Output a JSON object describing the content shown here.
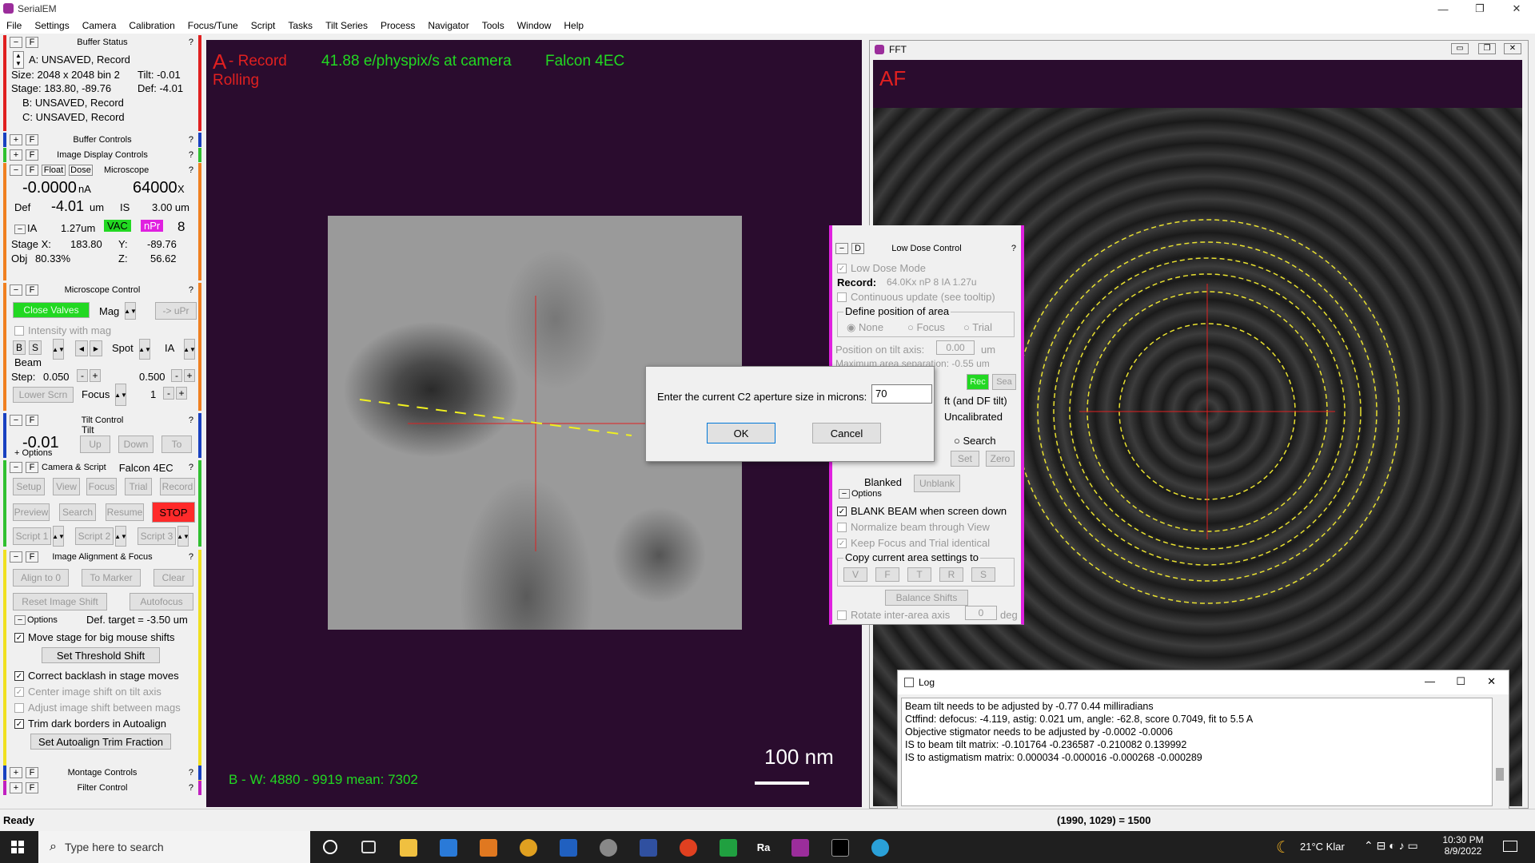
{
  "app": {
    "title": "SerialEM",
    "window_buttons": [
      "—",
      "❐",
      "✕"
    ]
  },
  "menu": [
    "File",
    "Settings",
    "Camera",
    "Calibration",
    "Focus/Tune",
    "Script",
    "Tasks",
    "Tilt Series",
    "Process",
    "Navigator",
    "Tools",
    "Window",
    "Help"
  ],
  "buffer_status": {
    "header": "Buffer Status",
    "a_line": "A: UNSAVED, Record",
    "size": "Size: 2048 x 2048  bin 2",
    "tilt": "Tilt: -0.01",
    "stage": "Stage: 183.80, -89.76",
    "def": "Def: -4.01",
    "b_line": "B: UNSAVED, Record",
    "c_line": "C: UNSAVED, Record"
  },
  "buffer_controls": "Buffer Controls",
  "image_display_controls": "Image Display Controls",
  "microscope": {
    "float_btn": "Float",
    "dose_btn": "Dose",
    "header": "Microscope",
    "current": "-0.0000",
    "current_unit": "nA",
    "mag": "64000",
    "mag_unit": "X",
    "def_label": "Def",
    "def_value": "-4.01",
    "def_unit": "um",
    "is_label": "IS",
    "is_value": "3.00 um",
    "ia_label": "IA",
    "ia_value": "1.27um",
    "vac": "VAC",
    "npr": "nPr",
    "spot": "8",
    "stage_x_label": "Stage X:",
    "stage_x": "183.80",
    "y_label": "Y:",
    "y": "-89.76",
    "obj_label": "Obj",
    "obj": "80.33%",
    "z_label": "Z:",
    "z": "56.62"
  },
  "microscope_control": {
    "header": "Microscope Control",
    "close_valves": "Close Valves",
    "mag": "Mag",
    "upr": "-> uPr",
    "intensity_with_mag": "Intensity with mag",
    "b": "B",
    "s": "S",
    "beam": "Beam",
    "spot": "Spot",
    "ia": "IA",
    "step_label": "Step:",
    "step1": "0.050",
    "step2": "0.500",
    "lower_scrn": "Lower Scrn",
    "focus": "Focus",
    "focus_step": "1"
  },
  "tilt_control": {
    "header": "Tilt Control",
    "tilt_label": "Tilt",
    "value": "-0.01",
    "up": "Up",
    "down": "Down",
    "to": "To",
    "options": "Options"
  },
  "camera_script": {
    "header": "Camera & Script",
    "camera": "Falcon 4EC",
    "setup": "Setup",
    "view": "View",
    "focus": "Focus",
    "trial": "Trial",
    "record": "Record",
    "preview": "Preview",
    "search": "Search",
    "resume": "Resume",
    "stop": "STOP",
    "script1": "Script 1",
    "script2": "Script 2",
    "script3": "Script 3"
  },
  "image_alignment": {
    "header": "Image Alignment & Focus",
    "align_to_0": "Align to 0",
    "to_marker": "To Marker",
    "clear": "Clear",
    "reset_is": "Reset Image Shift",
    "autofocus": "Autofocus",
    "options": "Options",
    "def_target": "Def. target = -3.50 um",
    "move_stage": "Move stage for big mouse shifts",
    "set_threshold": "Set Threshold Shift",
    "correct_backlash": "Correct backlash in stage moves",
    "center_is": "Center image shift on tilt axis",
    "adjust_is": "Adjust image shift between mags",
    "trim_dark": "Trim dark borders in Autoalign",
    "set_trim": "Set Autoalign Trim Fraction"
  },
  "montage_controls": "Montage Controls",
  "filter_control": "Filter Control",
  "image_window": {
    "a_label": "A",
    "record": " - Record",
    "rolling": "Rolling",
    "dose_rate": "41.88 e/physpix/s at camera",
    "camera": "Falcon 4EC",
    "bw": "B - W: 4880 - 9919  mean: 7302",
    "scale": "100 nm"
  },
  "fft_window": {
    "title": "FFT",
    "label": "AF"
  },
  "low_dose": {
    "d": "D",
    "header": "Low Dose Control",
    "mode": "Low Dose Mode",
    "record_label": "Record:",
    "record_info": "64.0Kx  nP 8  IA 1.27u",
    "continuous": "Continuous update (see tooltip)",
    "define": "Define position of area",
    "none": "None",
    "focus": "Focus",
    "trial": "Trial",
    "pos_label": "Position on tilt axis:",
    "pos_value": "0.00",
    "pos_unit": "um",
    "max_sep": "Maximum area separation: -0.55 um",
    "rec": "Rec",
    "sea": "Sea",
    "df_tilt": "ft (and DF tilt)",
    "uncal": "Uncalibrated",
    "search": "Search",
    "set": "Set",
    "zero": "Zero",
    "blanked": "Blanked",
    "unblank": "Unblank",
    "options": "Options",
    "blank_beam": "BLANK BEAM when screen down",
    "normalize": "Normalize beam through View",
    "keep_focus": "Keep Focus and Trial identical",
    "copy": "Copy current area settings to",
    "v": "V",
    "f": "F",
    "t": "T",
    "r": "R",
    "s": "S",
    "balance": "Balance Shifts",
    "rotate": "Rotate inter-area axis",
    "rotate_value": "0",
    "deg": "deg"
  },
  "prompt": {
    "text": "Enter the current C2 aperture size in microns:",
    "value": "70",
    "ok": "OK",
    "cancel": "Cancel"
  },
  "log": {
    "title": "Log",
    "lines": [
      "Beam tilt needs to be adjusted by -0.77  0.44 milliradians",
      "Ctffind: defocus: -4.119,  astig: 0.021 um,  angle: -62.8,  score 0.7049,   fit to 5.5 A",
      "Objective stigmator needs to be adjusted by -0.0002  -0.0006",
      "IS to beam tilt matrix: -0.101764  -0.236587  -0.210082  0.139992",
      "IS to astigmatism matrix: 0.000034  -0.000016  -0.000268  -0.000289"
    ]
  },
  "status": {
    "ready": "Ready",
    "coords": "(1990, 1029) = 1500"
  },
  "taskbar": {
    "search": "Type here to search",
    "weather": "21°C  Klar",
    "time": "10:30 PM",
    "date": "8/9/2022"
  }
}
